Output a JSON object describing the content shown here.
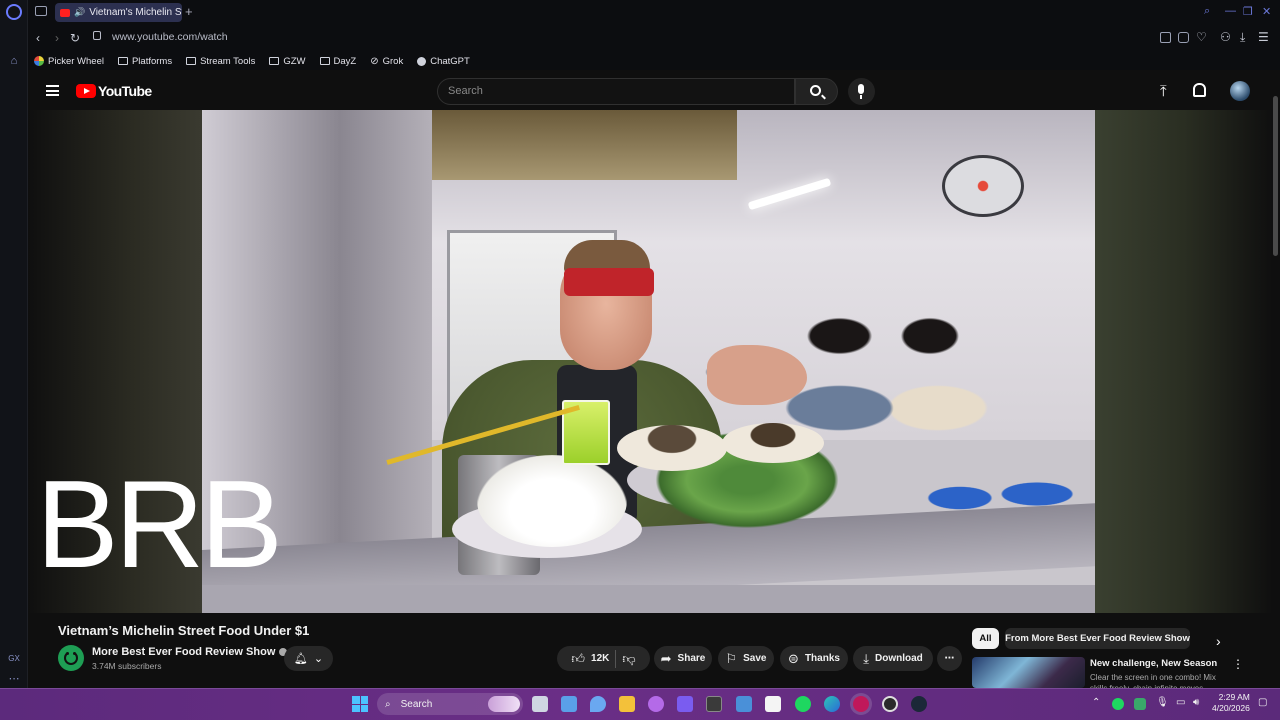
{
  "browser": {
    "tab_title": "Vietnam's Michelin Stre",
    "url": "www.youtube.com/watch",
    "sidebar_bottom_label": "GX",
    "bookmarks": [
      {
        "label": "Picker Wheel",
        "icon": "picker-wheel-icon"
      },
      {
        "label": "Platforms",
        "icon": "folder-icon"
      },
      {
        "label": "Stream Tools",
        "icon": "folder-icon"
      },
      {
        "label": "GZW",
        "icon": "folder-icon"
      },
      {
        "label": "DayZ",
        "icon": "folder-icon"
      },
      {
        "label": "Grok",
        "icon": "grok-icon"
      },
      {
        "label": "ChatGPT",
        "icon": "chatgpt-icon"
      }
    ]
  },
  "youtube": {
    "logo_text": "YouTube",
    "search_placeholder": "Search",
    "video_overlay_text": "BRB",
    "video_title": "Vietnam’s Michelin Street Food Under $1",
    "channel_name": "More Best Ever Food Review Show",
    "subscribers": "3.74M subscribers",
    "likes": "12K",
    "actions": {
      "share": "Share",
      "save": "Save",
      "thanks": "Thanks",
      "download": "Download"
    },
    "chips": [
      "All",
      "From More Best Ever Food Review Show"
    ],
    "recommendation": {
      "title": "New challenge, New Season",
      "description": "Clear the screen in one combo! Mix skills freely, chain infinite moves"
    }
  },
  "taskbar": {
    "search_label": "Search",
    "time": "2:29 AM",
    "date": "4/20/2026"
  },
  "colors": {
    "youtube_red": "#ff0000",
    "taskbar_purple": "#6a2e86",
    "opera_accent": "#6b7cff"
  }
}
